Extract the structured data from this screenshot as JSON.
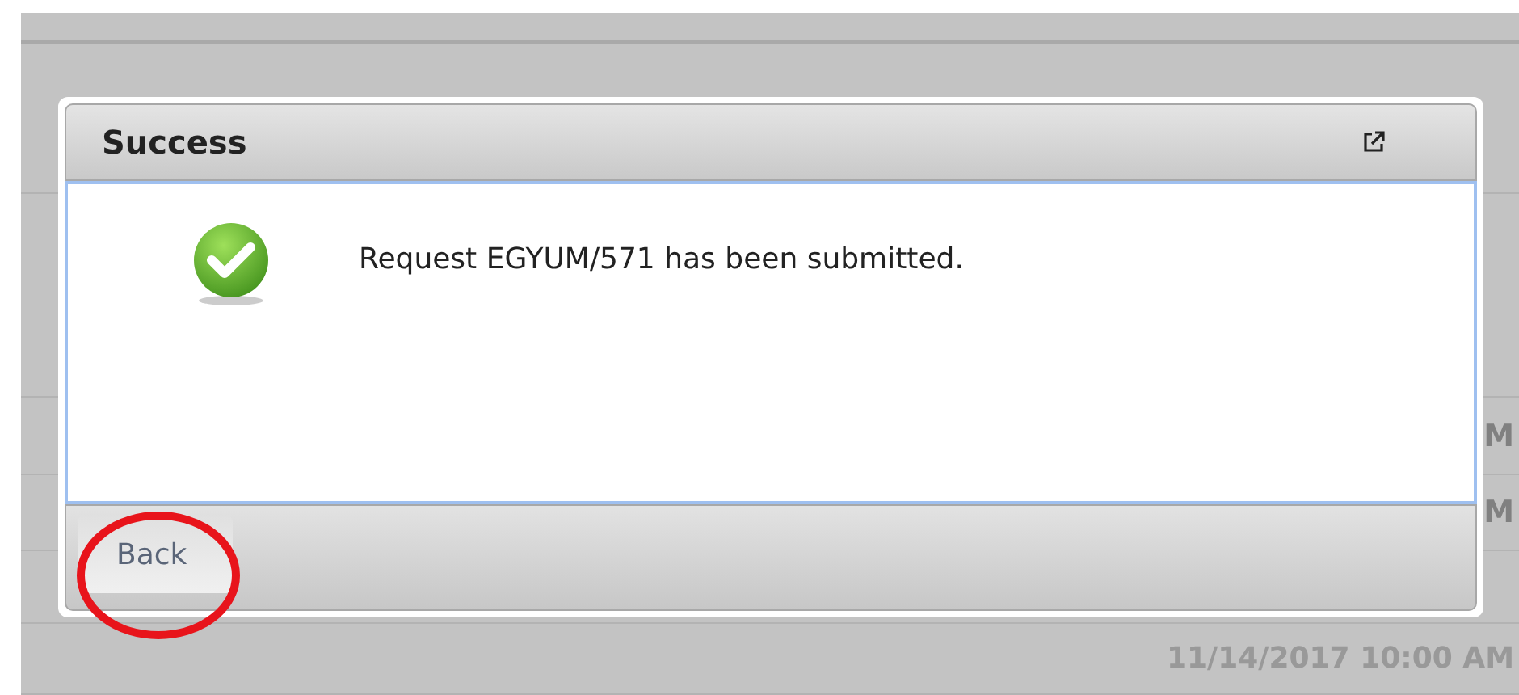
{
  "background": {
    "row_texts": [
      "M",
      "M"
    ],
    "date": "11/14/2017 10:00 AM"
  },
  "dialog": {
    "title": "Success",
    "message": "Request EGYUM/571 has been submitted.",
    "buttons": [
      "Back"
    ]
  },
  "annotation": {
    "kind": "circle",
    "color": "#e8141b"
  }
}
